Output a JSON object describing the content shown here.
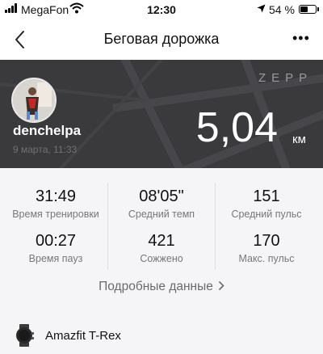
{
  "status_bar": {
    "carrier": "MegaFon",
    "time": "12:30",
    "battery": "54 %"
  },
  "nav": {
    "title": "Беговая дорожка"
  },
  "workout": {
    "brand": "ZEPP",
    "username": "denchelpa",
    "date": "9 марта, 11:33",
    "distance": "5,04",
    "distance_unit": "км"
  },
  "stats": [
    {
      "value": "31:49",
      "label": "Время тренировки"
    },
    {
      "value": "08'05\"",
      "label": "Средний темп"
    },
    {
      "value": "151",
      "label": "Средний пульс"
    },
    {
      "value": "00:27",
      "label": "Время пауз"
    },
    {
      "value": "421",
      "label": "Сожжено"
    },
    {
      "value": "170",
      "label": "Макс. пульс"
    }
  ],
  "details_label": "Подробные данные",
  "device": {
    "name": "Amazfit T-Rex"
  },
  "colors": {
    "banner": "#3a3a3d",
    "stats_background": "#f5f5f7"
  }
}
